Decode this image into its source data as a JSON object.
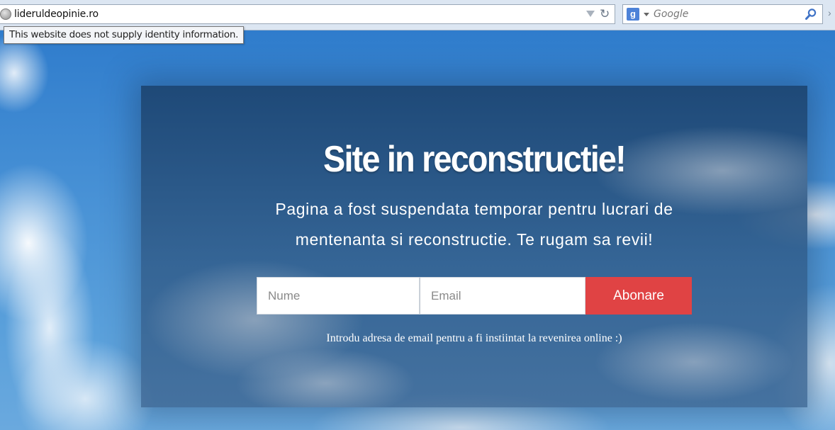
{
  "browser": {
    "url": "lideruldeopinie.ro",
    "search_placeholder": "Google",
    "identity_tooltip": "This website does not supply identity information.",
    "icons": {
      "site_identity": "globe-icon",
      "url_history": "chevron-down-icon",
      "reload": "reload-icon",
      "search_engine": "google-icon",
      "search_submit": "search-icon"
    }
  },
  "page": {
    "title": "Site in reconstructie!",
    "message": "Pagina a fost suspendata temporar pentru lucrari de mentenanta si reconstructie. Te rugam sa revii!",
    "form": {
      "name_placeholder": "Nume",
      "email_placeholder": "Email",
      "submit_label": "Abonare"
    },
    "note": "Introdu adresa de email pentru a fi instiintat la revenirea online :)"
  },
  "colors": {
    "accent_button": "#e04344",
    "panel_overlay": "#1c4470",
    "sky": "#4a93d6"
  }
}
